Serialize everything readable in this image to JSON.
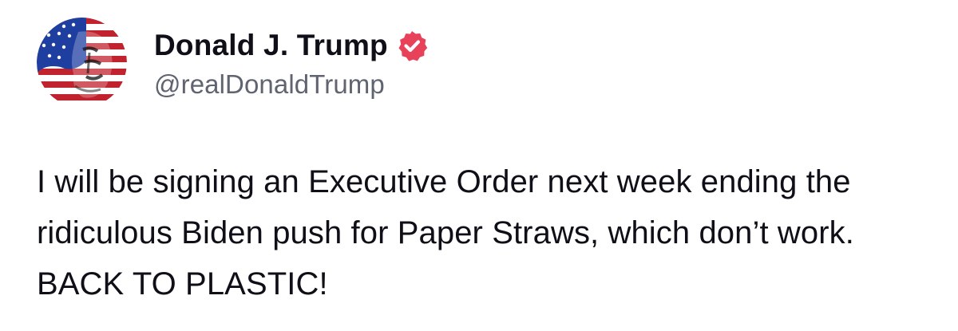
{
  "post": {
    "author": {
      "display_name": "Donald J. Trump",
      "handle": "@realDonaldTrump",
      "verified": true
    },
    "text": "I will be signing an Executive Order next week ending the ridiculous Biden push for Paper Straws, which don’t work. BACK TO PLASTIC!"
  },
  "colors": {
    "verified_badge": "#e8415a",
    "handle": "#5f6470",
    "text": "#0f0f17",
    "avatar_blue": "#1f3fa0",
    "avatar_red": "#c0222e"
  },
  "icons": {
    "avatar": "flag-portrait-avatar",
    "verified": "verified-badge-icon"
  }
}
